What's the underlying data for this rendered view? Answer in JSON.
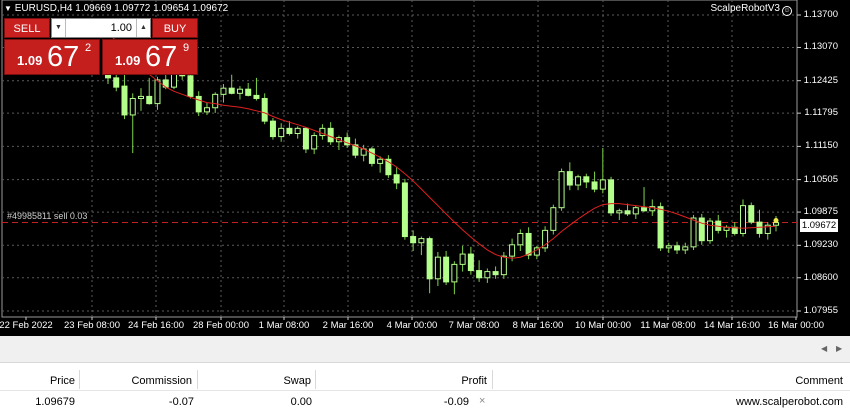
{
  "chart": {
    "symbol_text": "EURUSD,H4  1.09669 1.09772 1.09654 1.09672",
    "ea_name": "ScalpeRobotV3",
    "ea_icon": "smiley-icon",
    "order_label": "#49985811 sell 0.03",
    "current_price": "1.09672",
    "y_axis_labels": [
      "1.13700",
      "1.13070",
      "1.12425",
      "1.11795",
      "1.11150",
      "1.10505",
      "1.09875",
      "1.09230",
      "1.08600",
      "1.07955"
    ],
    "x_axis_labels": [
      "22 Feb 2022",
      "23 Feb 08:00",
      "24 Feb 16:00",
      "28 Feb 00:00",
      "1 Mar 08:00",
      "2 Mar 16:00",
      "4 Mar 00:00",
      "7 Mar 08:00",
      "8 Mar 16:00",
      "10 Mar 00:00",
      "11 Mar 08:00",
      "14 Mar 16:00",
      "16 Mar 00:00"
    ],
    "colors": {
      "background": "#000000",
      "candle": "#b4ff8c",
      "wick": "#7fd44a",
      "moving_average": "#e02020",
      "grid": "#5a5a5a",
      "order_line": "#c02020"
    }
  },
  "trade_panel": {
    "sell_label": "SELL",
    "buy_label": "BUY",
    "lot": "1.00",
    "sell_prefix": "1.09",
    "sell_big": "67",
    "sell_sup": "2",
    "buy_prefix": "1.09",
    "buy_big": "67",
    "buy_sup": "9",
    "color": "#c41e1d"
  },
  "table": {
    "headers": {
      "price": "Price",
      "commission": "Commission",
      "swap": "Swap",
      "profit": "Profit",
      "comment": "Comment"
    },
    "row": {
      "price": "1.09679",
      "commission": "-0.07",
      "swap": "0.00",
      "profit": "-0.09",
      "close": "×",
      "comment": "www.scalperobot.com"
    }
  },
  "chart_data": {
    "type": "candlestick",
    "timeframe": "H4",
    "ylim": [
      1.0795,
      1.1385
    ],
    "grid": true,
    "candles": [
      [
        1.1268,
        1.1274,
        1.1236,
        1.1248
      ],
      [
        1.1248,
        1.1258,
        1.1222,
        1.123
      ],
      [
        1.1232,
        1.1254,
        1.1168,
        1.1176
      ],
      [
        1.1176,
        1.1218,
        1.1102,
        1.1208
      ],
      [
        1.1208,
        1.1228,
        1.1184,
        1.1212
      ],
      [
        1.1212,
        1.1248,
        1.1196,
        1.1198
      ],
      [
        1.1198,
        1.125,
        1.1186,
        1.1244
      ],
      [
        1.1244,
        1.1268,
        1.1226,
        1.123
      ],
      [
        1.123,
        1.129,
        1.1226,
        1.1276
      ],
      [
        1.1276,
        1.13,
        1.1244,
        1.1252
      ],
      [
        1.1252,
        1.1266,
        1.1208,
        1.1212
      ],
      [
        1.1212,
        1.1222,
        1.1174,
        1.1182
      ],
      [
        1.1182,
        1.12,
        1.1176,
        1.119
      ],
      [
        1.119,
        1.122,
        1.118,
        1.1216
      ],
      [
        1.1216,
        1.1236,
        1.12,
        1.1228
      ],
      [
        1.1228,
        1.1254,
        1.1216,
        1.1218
      ],
      [
        1.1218,
        1.1232,
        1.1206,
        1.1226
      ],
      [
        1.1226,
        1.1238,
        1.1212,
        1.1214
      ],
      [
        1.1214,
        1.1248,
        1.1204,
        1.1208
      ],
      [
        1.1208,
        1.1218,
        1.1158,
        1.1164
      ],
      [
        1.1164,
        1.117,
        1.1128,
        1.1134
      ],
      [
        1.1134,
        1.116,
        1.1124,
        1.115
      ],
      [
        1.115,
        1.1164,
        1.1136,
        1.114
      ],
      [
        1.114,
        1.1154,
        1.113,
        1.115
      ],
      [
        1.115,
        1.1152,
        1.1102,
        1.111
      ],
      [
        1.111,
        1.1142,
        1.11,
        1.1136
      ],
      [
        1.1136,
        1.1158,
        1.1128,
        1.115
      ],
      [
        1.115,
        1.1162,
        1.1118,
        1.1124
      ],
      [
        1.1124,
        1.1136,
        1.1108,
        1.1132
      ],
      [
        1.1132,
        1.1142,
        1.1112,
        1.1118
      ],
      [
        1.1118,
        1.113,
        1.1092,
        1.1098
      ],
      [
        1.1098,
        1.1118,
        1.1086,
        1.111
      ],
      [
        1.111,
        1.1114,
        1.1076,
        1.1082
      ],
      [
        1.1082,
        1.1096,
        1.1064,
        1.109
      ],
      [
        1.109,
        1.1098,
        1.1054,
        1.106
      ],
      [
        1.106,
        1.1074,
        1.1032,
        1.1044
      ],
      [
        1.1044,
        1.1052,
        1.0934,
        1.094
      ],
      [
        1.094,
        1.0952,
        1.0912,
        1.0928
      ],
      [
        1.0928,
        1.094,
        1.0904,
        1.0936
      ],
      [
        1.0936,
        1.094,
        1.083,
        1.0858
      ],
      [
        1.0858,
        1.091,
        1.0844,
        1.09
      ],
      [
        1.09,
        1.0912,
        1.0846,
        1.0852
      ],
      [
        1.0852,
        1.0892,
        1.0828,
        1.0886
      ],
      [
        1.0886,
        1.0922,
        1.0872,
        1.0906
      ],
      [
        1.0906,
        1.092,
        1.0866,
        1.0874
      ],
      [
        1.0874,
        1.0894,
        1.0852,
        1.086
      ],
      [
        1.086,
        1.0878,
        1.085,
        1.0872
      ],
      [
        1.0872,
        1.0882,
        1.0858,
        1.0866
      ],
      [
        1.0866,
        1.091,
        1.0858,
        1.0902
      ],
      [
        1.0902,
        1.0936,
        1.0892,
        1.0924
      ],
      [
        1.0924,
        1.0954,
        1.0912,
        1.0946
      ],
      [
        1.0946,
        1.0958,
        1.0896,
        1.0904
      ],
      [
        1.0904,
        1.0922,
        1.0896,
        1.0918
      ],
      [
        1.0918,
        1.096,
        1.091,
        1.0952
      ],
      [
        1.0952,
        1.1002,
        1.0944,
        1.0996
      ],
      [
        1.0996,
        1.1072,
        1.099,
        1.1066
      ],
      [
        1.1066,
        1.1084,
        1.103,
        1.104
      ],
      [
        1.104,
        1.106,
        1.103,
        1.1056
      ],
      [
        1.1056,
        1.1062,
        1.1034,
        1.1046
      ],
      [
        1.1046,
        1.1066,
        1.1026,
        1.1032
      ],
      [
        1.1032,
        1.1112,
        1.1024,
        1.105
      ],
      [
        1.105,
        1.1056,
        1.098,
        1.0986
      ],
      [
        1.0986,
        1.0994,
        1.0972,
        1.099
      ],
      [
        1.099,
        1.1004,
        1.098,
        1.0984
      ],
      [
        1.0984,
        1.1,
        1.0974,
        1.0996
      ],
      [
        1.0996,
        1.1036,
        1.0988,
        1.099
      ],
      [
        1.099,
        1.1012,
        1.098,
        1.0998
      ],
      [
        1.0998,
        1.1006,
        1.0912,
        1.0918
      ],
      [
        1.0918,
        1.0928,
        1.0908,
        1.0922
      ],
      [
        1.0922,
        1.093,
        1.0906,
        1.0914
      ],
      [
        1.0914,
        1.0928,
        1.0906,
        1.092
      ],
      [
        1.092,
        1.0982,
        1.0914,
        1.0976
      ],
      [
        1.0976,
        1.0984,
        1.0924,
        1.0932
      ],
      [
        1.0932,
        1.0976,
        1.0926,
        1.097
      ],
      [
        1.097,
        1.0982,
        1.0946,
        1.0952
      ],
      [
        1.0952,
        1.0962,
        1.0938,
        1.0958
      ],
      [
        1.0958,
        1.0968,
        1.0942,
        1.0946
      ],
      [
        1.0946,
        1.1012,
        1.094,
        1.1
      ],
      [
        1.1,
        1.1006,
        1.0964,
        1.0968
      ],
      [
        1.0968,
        1.0992,
        1.0938,
        1.0946
      ],
      [
        1.0946,
        1.0968,
        1.0934,
        1.0962
      ],
      [
        1.0962,
        1.098,
        1.095,
        1.0967
      ]
    ],
    "moving_average": [
      1.1335,
      1.132,
      1.1302,
      1.1286,
      1.127,
      1.1255,
      1.1242,
      1.123,
      1.1222,
      1.1216,
      1.121,
      1.1205,
      1.12,
      1.1198,
      1.1195,
      1.1193,
      1.1191,
      1.1188,
      1.1184,
      1.118,
      1.1173,
      1.1167,
      1.1162,
      1.1157,
      1.1152,
      1.1146,
      1.114,
      1.1134,
      1.1128,
      1.1122,
      1.1116,
      1.111,
      1.1102,
      1.1094,
      1.1085,
      1.1075,
      1.1062,
      1.1048,
      1.1032,
      1.1016,
      1.1,
      1.0984,
      1.0968,
      1.0953,
      1.0939,
      1.0926,
      1.0914,
      1.0905,
      1.09,
      1.0898,
      1.09,
      1.0906,
      1.0914,
      1.0924,
      1.0936,
      1.095,
      1.0962,
      1.0974,
      1.0985,
      1.0995,
      1.1002,
      1.1004,
      1.1004,
      1.1002,
      1.1,
      1.0998,
      1.0996,
      1.0993,
      1.0989,
      1.0984,
      1.0978,
      1.0972,
      1.0966,
      1.0962,
      1.096,
      1.0958,
      1.0957,
      1.0956,
      1.0957,
      1.0958,
      1.0959,
      1.096
    ]
  }
}
